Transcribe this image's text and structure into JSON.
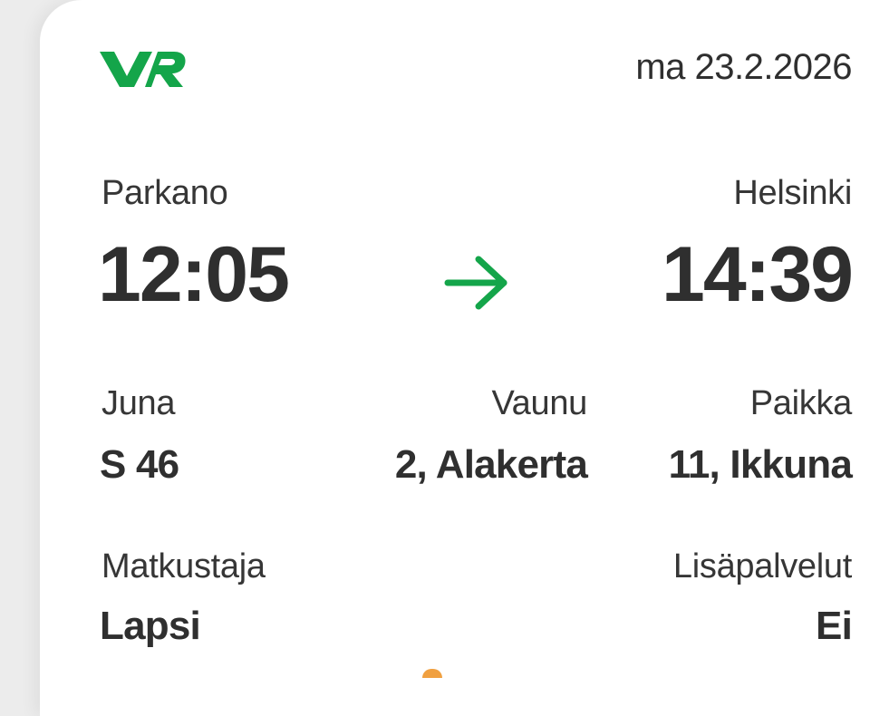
{
  "header": {
    "logo_text": "VR",
    "date": "ma 23.2.2026"
  },
  "journey": {
    "from_station": "Parkano",
    "departure_time": "12:05",
    "to_station": "Helsinki",
    "arrival_time": "14:39",
    "arrow_icon": "arrow-right-icon"
  },
  "details": {
    "train_label": "Juna",
    "train_value": "S 46",
    "car_label": "Vaunu",
    "car_value": "2, Alakerta",
    "seat_label": "Paikka",
    "seat_value": "11, Ikkuna",
    "passenger_label": "Matkustaja",
    "passenger_value": "Lapsi",
    "extras_label": "Lisäpalvelut",
    "extras_value": "Ei"
  },
  "colors": {
    "brand_green": "#14a54a",
    "text": "#2f2f2f",
    "background": "#ececec",
    "card": "#ffffff"
  }
}
